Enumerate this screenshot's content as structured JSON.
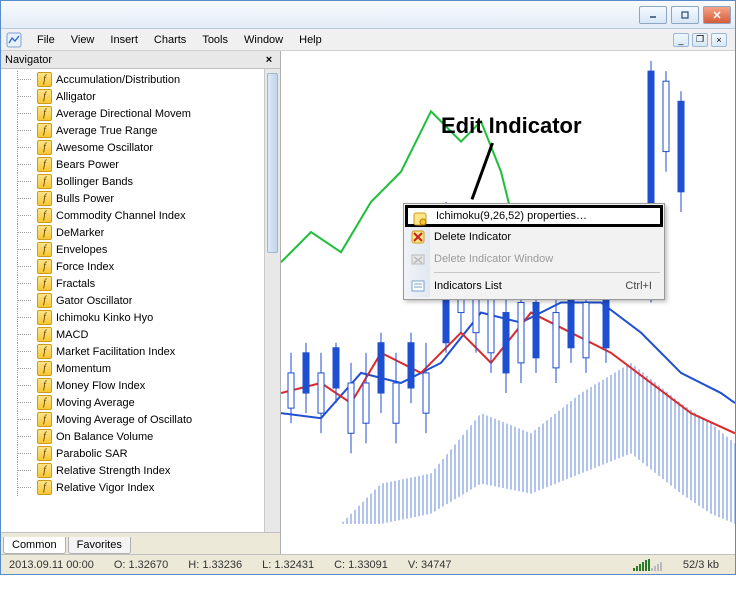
{
  "menu": {
    "items": [
      "File",
      "View",
      "Insert",
      "Charts",
      "Tools",
      "Window",
      "Help"
    ]
  },
  "navigator": {
    "title": "Navigator",
    "tabs": {
      "common": "Common",
      "favorites": "Favorites"
    },
    "items": [
      "Accumulation/Distribution",
      "Alligator",
      "Average Directional Movem",
      "Average True Range",
      "Awesome Oscillator",
      "Bears Power",
      "Bollinger Bands",
      "Bulls Power",
      "Commodity Channel Index",
      "DeMarker",
      "Envelopes",
      "Force Index",
      "Fractals",
      "Gator Oscillator",
      "Ichimoku Kinko Hyo",
      "MACD",
      "Market Facilitation Index",
      "Momentum",
      "Money Flow Index",
      "Moving Average",
      "Moving Average of Oscillato",
      "On Balance Volume",
      "Parabolic SAR",
      "Relative Strength Index",
      "Relative Vigor Index"
    ]
  },
  "context_menu": {
    "properties": "Ichimoku(9,26,52) properties…",
    "delete_indicator": "Delete Indicator",
    "delete_window": "Delete Indicator Window",
    "indicators_list": "Indicators List",
    "indicators_shortcut": "Ctrl+I"
  },
  "annotation": "Edit Indicator",
  "status": {
    "date": "2013.09.11 00:00",
    "open": "O: 1.32670",
    "high": "H: 1.33236",
    "low": "L: 1.32431",
    "close": "C: 1.33091",
    "volume": "V: 34747",
    "transfer": "52/3 kb"
  },
  "colors": {
    "tenkan": "#d92b2b",
    "kijun": "#1f4fd1",
    "chikou": "#1fbf3a",
    "candle_up": "#1f4fd1",
    "candle_dn": "#d92b2b"
  }
}
